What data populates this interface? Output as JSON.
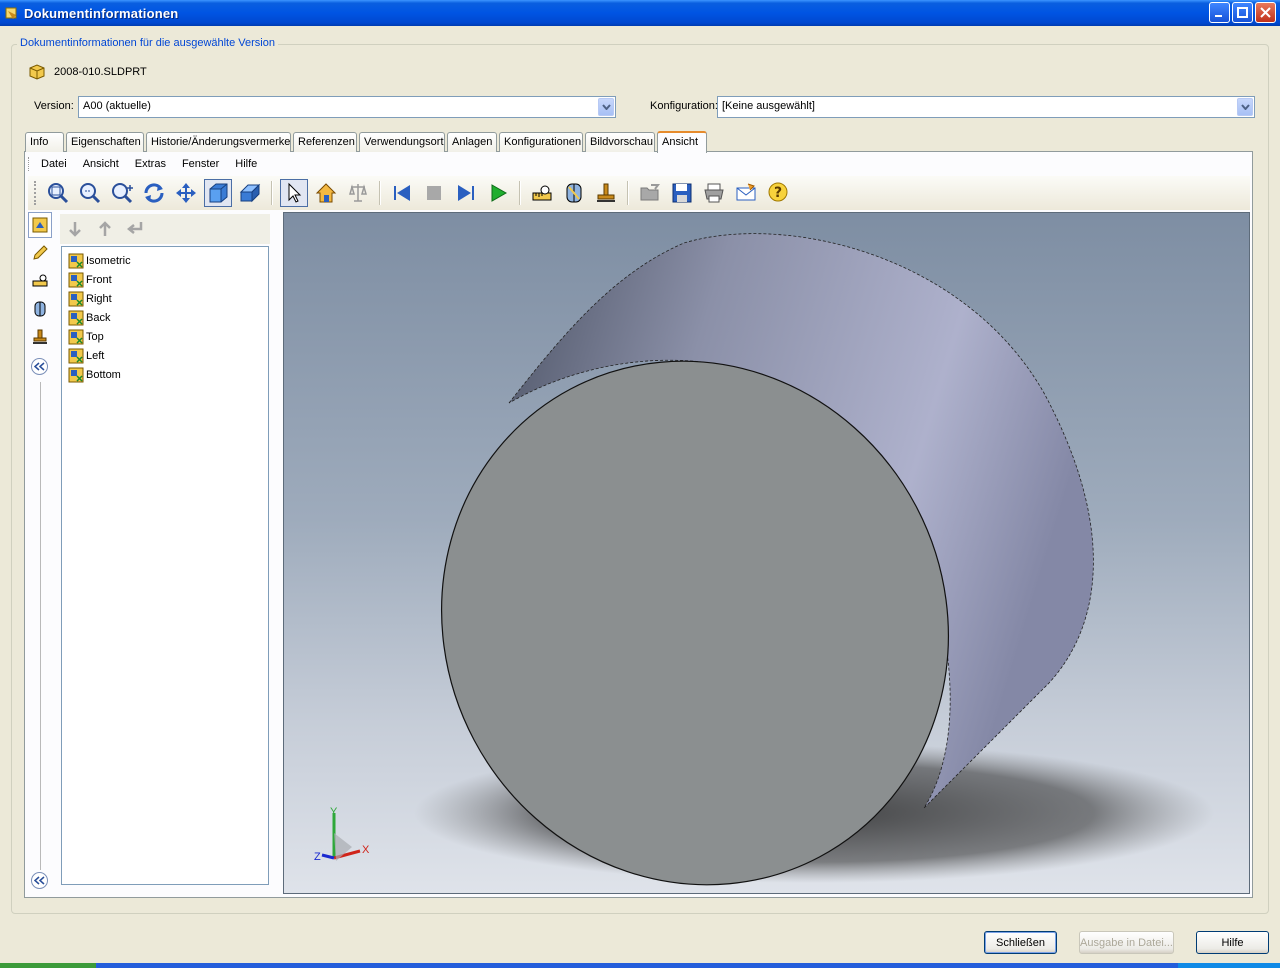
{
  "window": {
    "title": "Dokumentinformationen"
  },
  "group": {
    "legend": "Dokumentinformationen für die ausgewählte Version"
  },
  "file": {
    "name": "2008-010.SLDPRT"
  },
  "version": {
    "label": "Version:",
    "value": "A00 (aktuelle)"
  },
  "configuration": {
    "label": "Konfiguration:",
    "value": "[Keine ausgewählt]"
  },
  "tabs": [
    {
      "label": "Info"
    },
    {
      "label": "Eigenschaften"
    },
    {
      "label": "Historie/Änderungsvermerke"
    },
    {
      "label": "Referenzen"
    },
    {
      "label": "Verwendungsort"
    },
    {
      "label": "Anlagen"
    },
    {
      "label": "Konfigurationen"
    },
    {
      "label": "Bildvorschau"
    },
    {
      "label": "Ansicht"
    }
  ],
  "active_tab": "Ansicht",
  "menu": [
    {
      "label": "Datei"
    },
    {
      "label": "Ansicht"
    },
    {
      "label": "Extras"
    },
    {
      "label": "Fenster"
    },
    {
      "label": "Hilfe"
    }
  ],
  "toolbar_icons": [
    "zoom-to-fit-icon",
    "zoom-to-area-icon",
    "zoom-in-out-icon",
    "rotate-icon",
    "pan-icon",
    "shaded-icon",
    "shaded-edges-icon",
    "select-icon",
    "home-view-icon",
    "balance-icon",
    "first-icon",
    "stop-icon",
    "next-icon",
    "play-icon",
    "measure-icon",
    "section-icon",
    "stamp-icon",
    "open-icon",
    "save-icon",
    "print-icon",
    "mail-icon",
    "help-icon"
  ],
  "views": [
    {
      "label": "Isometric"
    },
    {
      "label": "Front"
    },
    {
      "label": "Right"
    },
    {
      "label": "Back"
    },
    {
      "label": "Top"
    },
    {
      "label": "Left"
    },
    {
      "label": "Bottom"
    }
  ],
  "triad": {
    "x": "X",
    "y": "Y",
    "z": "Z"
  },
  "buttons": {
    "close": "Schließen",
    "export": "Ausgabe in Datei...",
    "help": "Hilfe"
  }
}
